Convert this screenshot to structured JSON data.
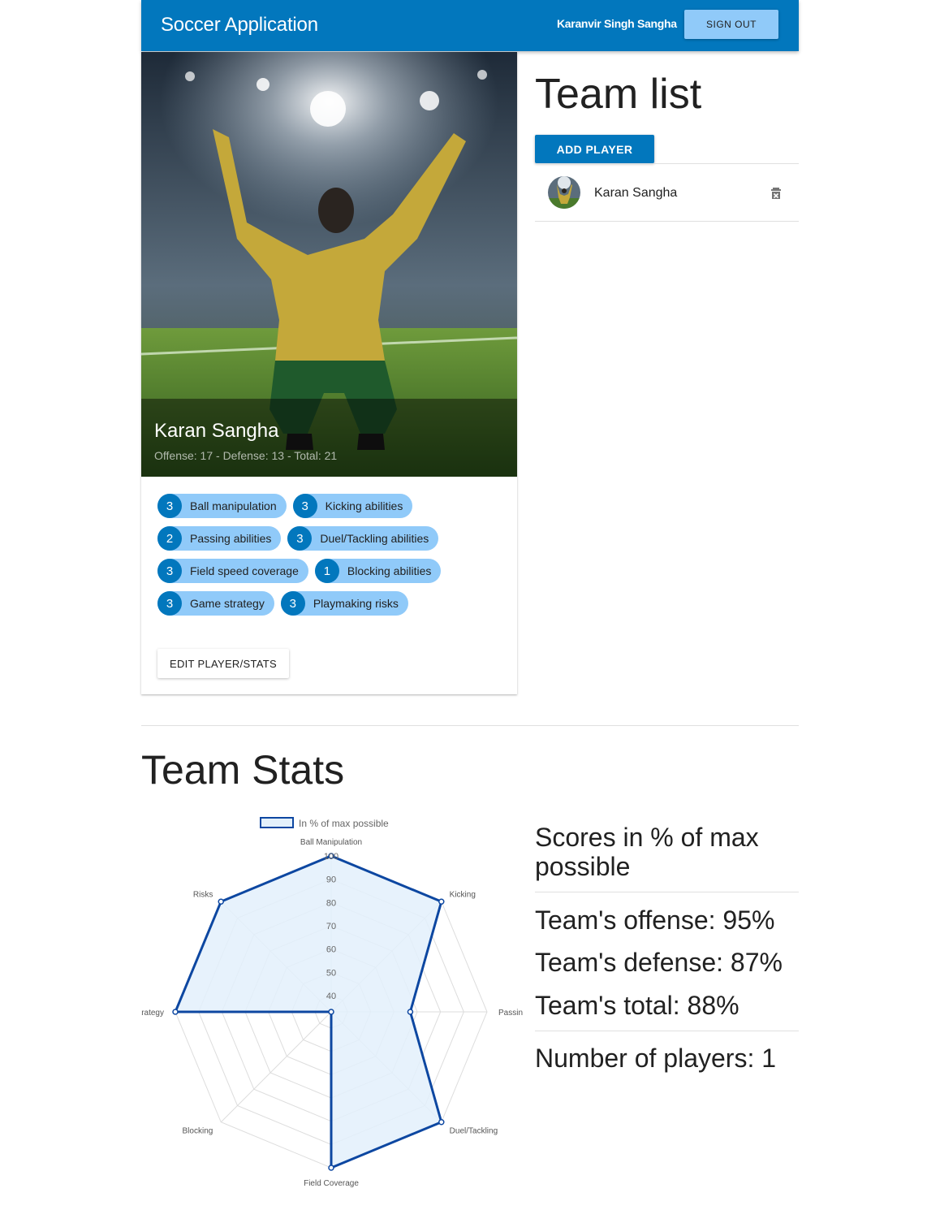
{
  "appbar": {
    "title": "Soccer Application",
    "user_name": "Karanvir Singh Sangha",
    "signout_label": "SIGN OUT"
  },
  "player_card": {
    "name": "Karan Sangha",
    "subtitle": "Offense: 17 - Defense: 13 - Total: 21",
    "chips": [
      [
        {
          "value": "3",
          "label": "Ball manipulation"
        },
        {
          "value": "3",
          "label": "Kicking abilities"
        }
      ],
      [
        {
          "value": "2",
          "label": "Passing abilities"
        },
        {
          "value": "3",
          "label": "Duel/Tackling abilities"
        }
      ],
      [
        {
          "value": "3",
          "label": "Field speed coverage"
        },
        {
          "value": "1",
          "label": "Blocking abilities"
        }
      ],
      [
        {
          "value": "3",
          "label": "Game strategy"
        },
        {
          "value": "3",
          "label": "Playmaking risks"
        }
      ]
    ],
    "edit_label": "EDIT PLAYER/STATS"
  },
  "team_list": {
    "title": "Team list",
    "add_label": "ADD PLAYER",
    "players": [
      {
        "name": "Karan Sangha"
      }
    ]
  },
  "team_stats": {
    "title": "Team Stats",
    "scores_title": "Scores in % of max possible",
    "offense": "Team's offense: 95%",
    "defense": "Team's defense: 87%",
    "total": "Team's total: 88%",
    "players": "Number of players: 1"
  },
  "colors": {
    "primary": "#0277bd",
    "chip": "#90caf9",
    "radar_line": "#0d47a1",
    "radar_fill": "#e3f0fb"
  },
  "chart_data": {
    "type": "radar",
    "legend": "In % of max possible",
    "legend_position": "top",
    "categories": [
      "Ball Manipulation",
      "Kicking",
      "Passing",
      "Duel/Tackling",
      "Field Coverage",
      "Blocking",
      "Strategy",
      "Risks"
    ],
    "series": [
      {
        "name": "In % of max possible",
        "values": [
          100,
          100,
          67,
          100,
          100,
          33,
          100,
          100
        ]
      }
    ],
    "rmin": 33,
    "rmax": 100,
    "ticks": [
      "40",
      "50",
      "60",
      "70",
      "80",
      "90",
      "100"
    ]
  }
}
